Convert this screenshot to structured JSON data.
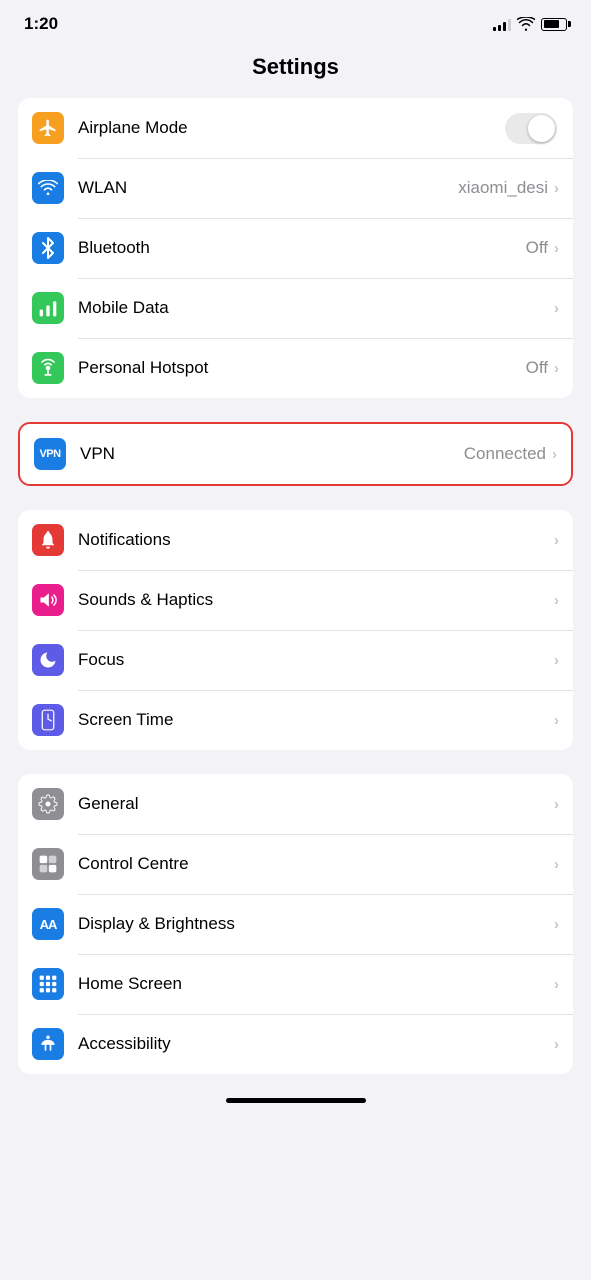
{
  "statusBar": {
    "time": "1:20",
    "signal": [
      3,
      5,
      7,
      9,
      11
    ],
    "wifi": true,
    "battery": 75
  },
  "pageTitle": "Settings",
  "groups": {
    "connectivity": {
      "items": [
        {
          "id": "airplane-mode",
          "label": "Airplane Mode",
          "iconBg": "bg-orange",
          "iconChar": "✈",
          "valueType": "toggle",
          "toggleOn": false
        },
        {
          "id": "wlan",
          "label": "WLAN",
          "iconBg": "bg-blue",
          "iconChar": "wifi",
          "value": "xiaomi_desi",
          "valueType": "chevron"
        },
        {
          "id": "bluetooth",
          "label": "Bluetooth",
          "iconBg": "bg-blue-dark",
          "iconChar": "bt",
          "value": "Off",
          "valueType": "chevron"
        },
        {
          "id": "mobile-data",
          "label": "Mobile Data",
          "iconBg": "bg-green",
          "iconChar": "signal",
          "value": "",
          "valueType": "chevron"
        },
        {
          "id": "personal-hotspot",
          "label": "Personal Hotspot",
          "iconBg": "bg-green2",
          "iconChar": "hotspot",
          "value": "Off",
          "valueType": "chevron"
        }
      ]
    },
    "vpn": {
      "id": "vpn",
      "label": "VPN",
      "iconBg": "bg-vpn",
      "iconChar": "VPN",
      "value": "Connected",
      "valueType": "chevron",
      "highlighted": true
    },
    "notifications": {
      "items": [
        {
          "id": "notifications",
          "label": "Notifications",
          "iconBg": "bg-red",
          "iconChar": "bell",
          "value": "",
          "valueType": "chevron"
        },
        {
          "id": "sounds-haptics",
          "label": "Sounds & Haptics",
          "iconBg": "bg-pink",
          "iconChar": "speaker",
          "value": "",
          "valueType": "chevron"
        },
        {
          "id": "focus",
          "label": "Focus",
          "iconBg": "bg-purple",
          "iconChar": "moon",
          "value": "",
          "valueType": "chevron"
        },
        {
          "id": "screen-time",
          "label": "Screen Time",
          "iconBg": "bg-purple2",
          "iconChar": "hourglass",
          "value": "",
          "valueType": "chevron"
        }
      ]
    },
    "general": {
      "items": [
        {
          "id": "general",
          "label": "General",
          "iconBg": "bg-gray",
          "iconChar": "gear",
          "value": "",
          "valueType": "chevron"
        },
        {
          "id": "control-centre",
          "label": "Control Centre",
          "iconBg": "bg-gray",
          "iconChar": "toggle",
          "value": "",
          "valueType": "chevron"
        },
        {
          "id": "display-brightness",
          "label": "Display & Brightness",
          "iconBg": "bg-blue-aa",
          "iconChar": "AA",
          "value": "",
          "valueType": "chevron"
        },
        {
          "id": "home-screen",
          "label": "Home Screen",
          "iconBg": "bg-blue-homescreen",
          "iconChar": "grid",
          "value": "",
          "valueType": "chevron"
        },
        {
          "id": "accessibility",
          "label": "Accessibility",
          "iconBg": "bg-blue-accessibility",
          "iconChar": "person",
          "value": "",
          "valueType": "chevron"
        }
      ]
    }
  }
}
